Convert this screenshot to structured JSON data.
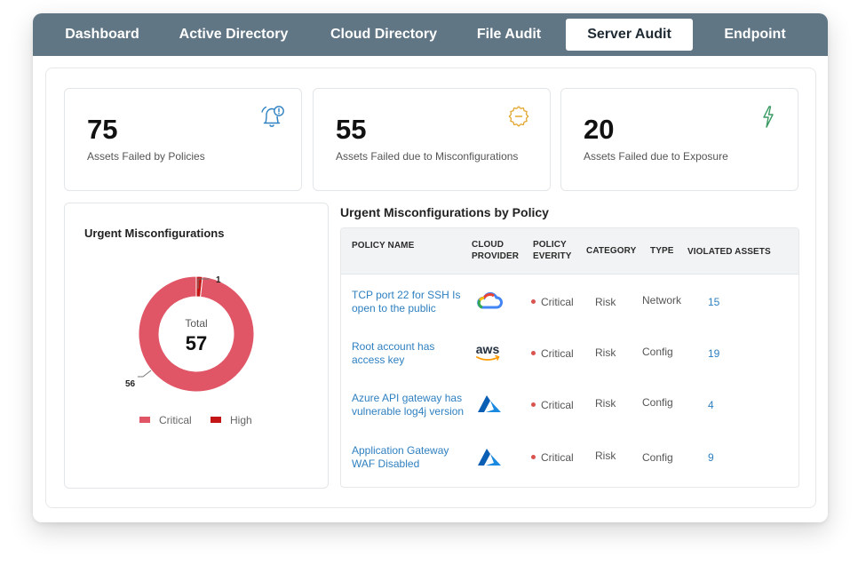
{
  "tabs": [
    "Dashboard",
    "Active Directory",
    "Cloud Directory",
    "File Audit",
    "Server Audit",
    "Endpoint"
  ],
  "active_tab": "Server Audit",
  "cards": [
    {
      "value": "75",
      "label": "Assets Failed by Policies",
      "icon": "alarm-bell-icon"
    },
    {
      "value": "55",
      "label": "Assets Failed due to Misconfigurations",
      "icon": "gear-icon"
    },
    {
      "value": "20",
      "label": "Assets Failed due to Exposure",
      "icon": "lightning-icon"
    }
  ],
  "donut": {
    "title": "Urgent Misconfigurations",
    "total_label": "Total",
    "total_value": "57",
    "label_critical_count": "56",
    "label_high_count": "1",
    "legend": [
      "Critical",
      "High"
    ],
    "colors": {
      "critical": "#e05666",
      "high": "#c41616"
    }
  },
  "chart_data": {
    "type": "pie",
    "categories": [
      "Critical",
      "High"
    ],
    "values": [
      56,
      1
    ],
    "title": "Urgent Misconfigurations"
  },
  "table": {
    "title": "Urgent Misconfigurations by Policy",
    "headers": {
      "policy_name": "POLICY NAME",
      "cloud_provider_1": "CLOUD",
      "cloud_provider_2": "PROVIDER",
      "policy_severity_1": "POLICY",
      "policy_severity_2": "EVERITY",
      "category": "CATEGORY",
      "type": "TYPE",
      "violated_assets": "VIOLATED ASSETS"
    },
    "rows": [
      {
        "policy": "TCP port 22 for SSH Is open to the public",
        "provider": "google-cloud-icon",
        "severity": "Critical",
        "category": "Risk",
        "type": "Network",
        "violated": "15"
      },
      {
        "policy": "Root account has access key",
        "provider": "aws-icon",
        "severity": "Critical",
        "category": "Risk",
        "type": "Config",
        "violated": "19"
      },
      {
        "policy": "Azure API gateway has vulnerable log4j version",
        "provider": "azure-icon",
        "severity": "Critical",
        "category": "Risk",
        "type": "Config",
        "violated": "4"
      },
      {
        "policy": "Application Gateway WAF Disabled",
        "provider": "azure-icon",
        "severity": "Critical",
        "category": "Risk",
        "type": "Config",
        "violated": "9"
      }
    ],
    "aws_text": "aws"
  }
}
